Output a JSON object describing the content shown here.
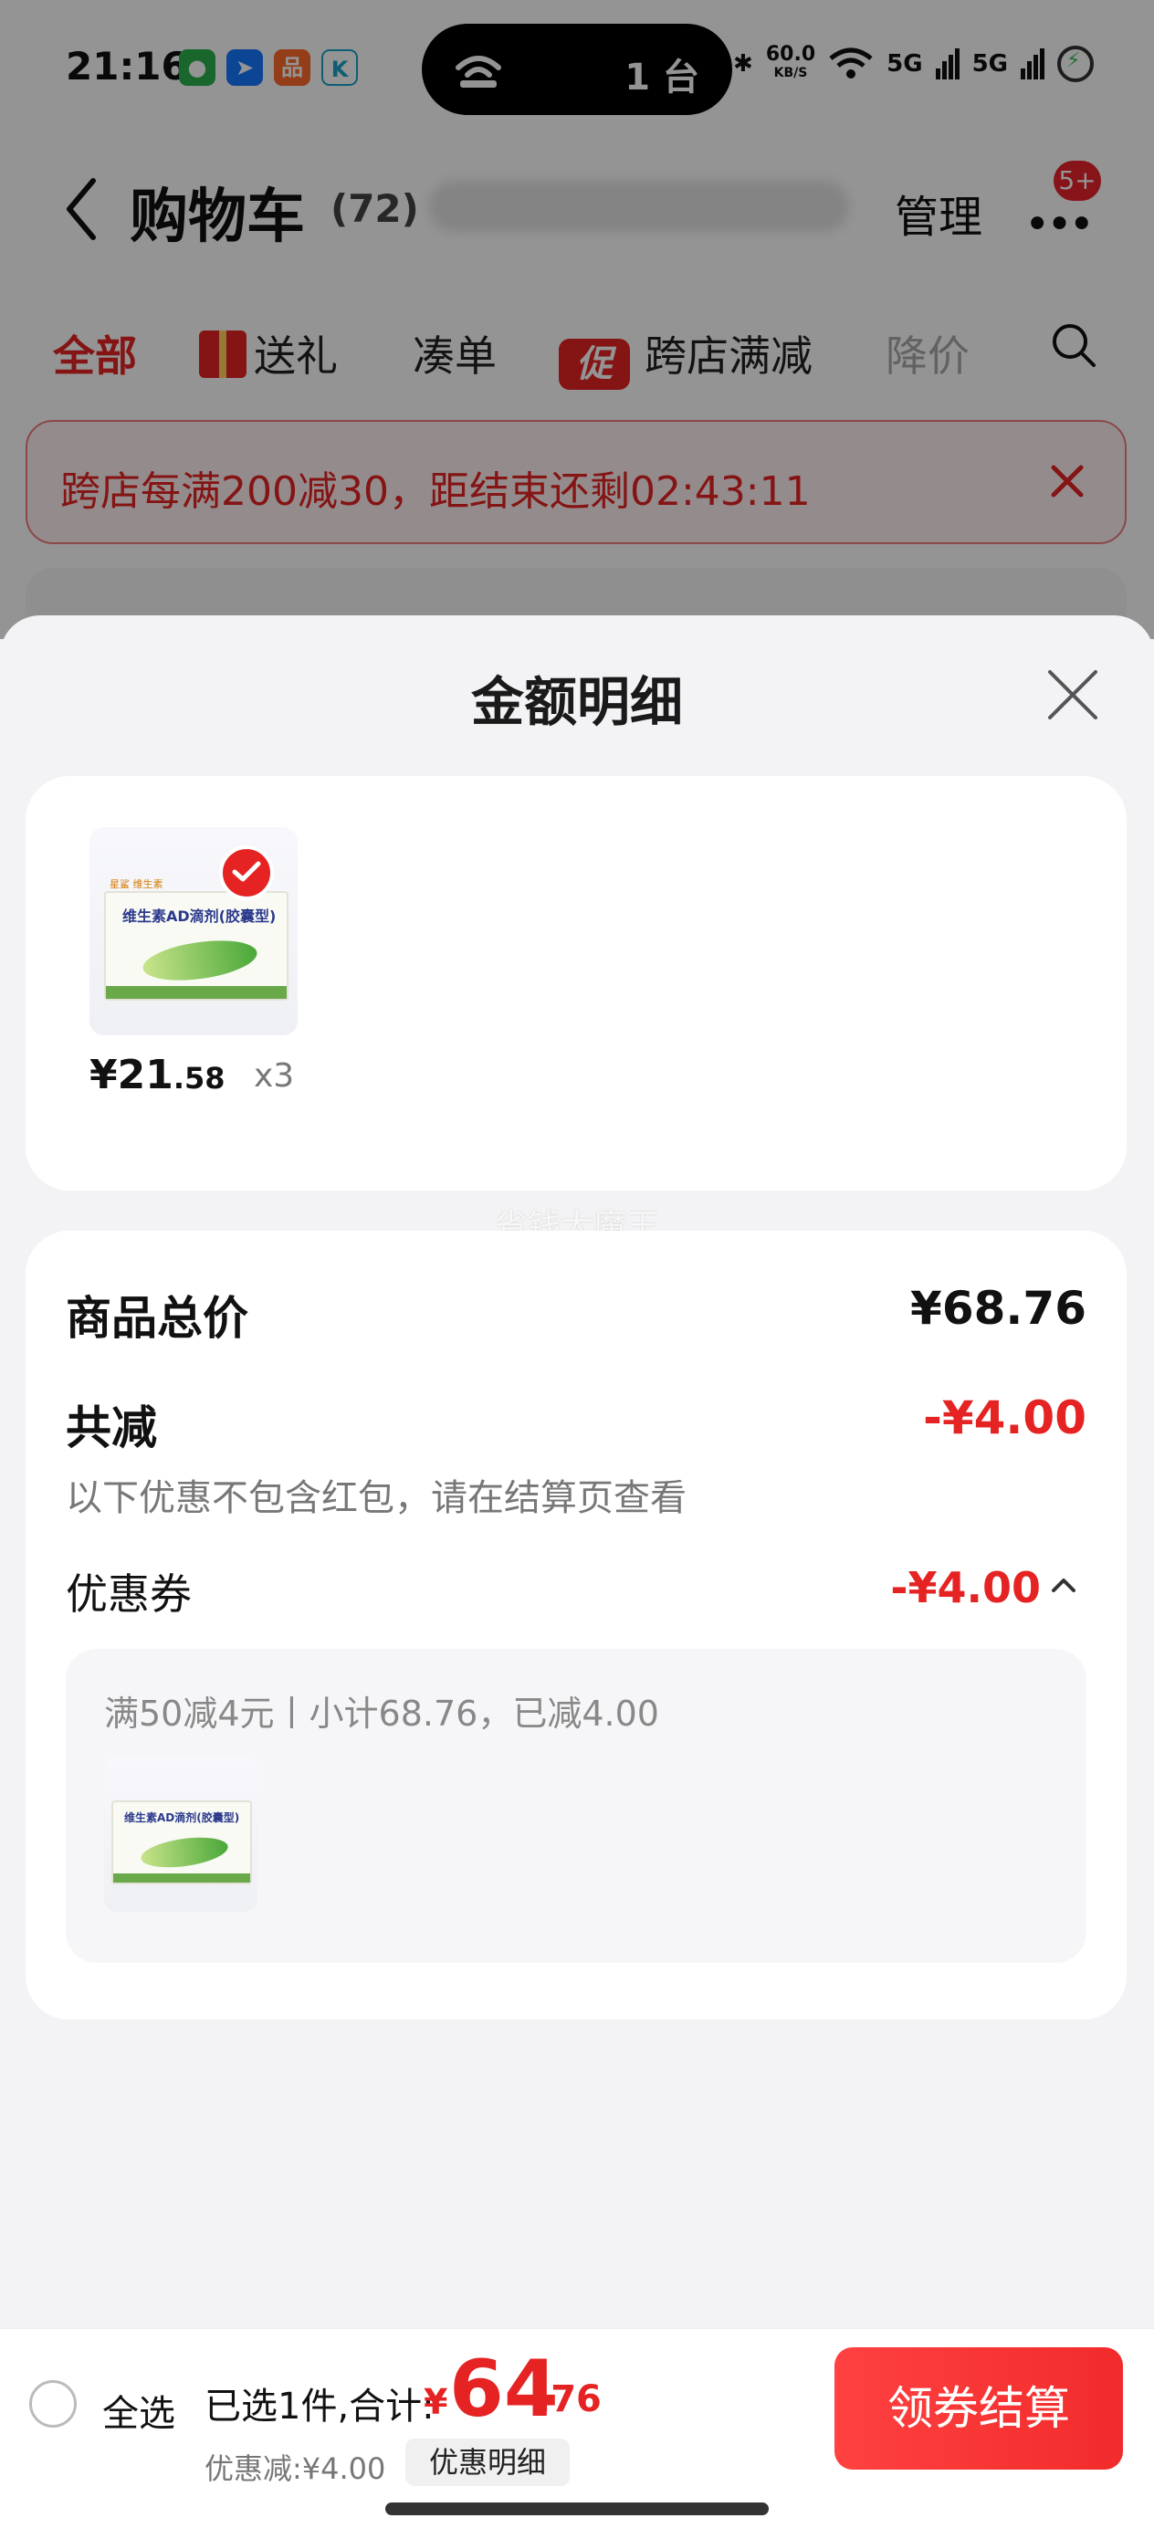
{
  "status_bar": {
    "time": "21:16",
    "island_count": "1 台",
    "net_speed": "60.0",
    "net_speed_unit": "KB/S",
    "signal_1": "5G",
    "signal_2": "5G"
  },
  "nav": {
    "title": "购物车",
    "count": "(72)",
    "manage": "管理",
    "more_badge": "5+"
  },
  "tabs": [
    {
      "label": "全部",
      "active": true
    },
    {
      "label": "送礼"
    },
    {
      "label": "凑单"
    },
    {
      "label": "跨店满减",
      "icon_text": "促"
    },
    {
      "label": "降价"
    }
  ],
  "promo_banner": {
    "text": "跨店每满200减30，距结束还剩02:43:11"
  },
  "sheet": {
    "title": "金额明细",
    "item": {
      "price_int": "¥21",
      "price_dec": ".58",
      "qty": "x3",
      "box_brand": "星鲨 维生素",
      "box_label": "维生素AD滴剂(胶囊型)"
    },
    "watermark": "省钱大魔王",
    "summary": {
      "goods_total_label": "商品总价",
      "goods_total_value": "¥68.76",
      "total_discount_label": "共减",
      "total_discount_value": "-¥4.00",
      "note": "以下优惠不包含红包，请在结算页查看",
      "coupon_label": "优惠券",
      "coupon_value": "-¥4.00",
      "coupon_desc": "满50减4元丨小计68.76，已减4.00"
    }
  },
  "bottom_bar": {
    "select_all": "全选",
    "selected_text": "已选1件,合计:",
    "currency": "¥",
    "total_int": "64",
    "total_dec": ".76",
    "discount_text": "优惠减:¥4.00",
    "detail_button": "优惠明细",
    "checkout_button": "领券结算"
  },
  "colors": {
    "accent": "#e52323",
    "checkout": "#f12b2b"
  }
}
